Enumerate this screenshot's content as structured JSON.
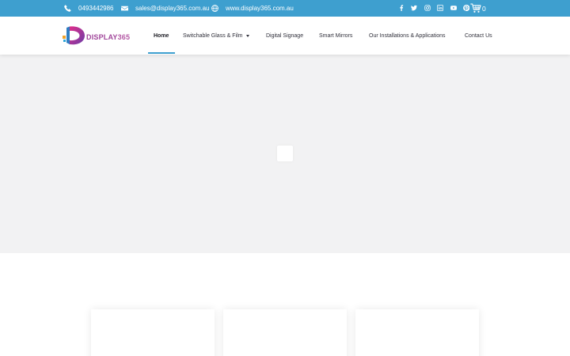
{
  "topbar": {
    "phone": "0493442986",
    "email": "sales@display365.com.au",
    "website": "www.display365.com.au",
    "phone_icon": "phone-icon",
    "email_icon": "envelope-icon",
    "website_icon": "globe-icon",
    "social": [
      "facebook-icon",
      "twitter-icon",
      "instagram-icon",
      "linkedin-icon",
      "youtube-icon",
      "pinterest-icon"
    ],
    "cart_count": "0",
    "background": "#3e9fcf"
  },
  "header": {
    "logo_text": "DISPLAY",
    "logo_num": "365",
    "nav": [
      {
        "label": "Home",
        "active": true
      },
      {
        "label": "Switchable Glass & Film",
        "dropdown": true
      },
      {
        "label": "Digital Signage"
      },
      {
        "label": "Smart Mirrors"
      },
      {
        "label": "Our Installations & Applications"
      },
      {
        "label": "Contact Us"
      }
    ],
    "accent": "#3e9fcf"
  },
  "hero": {
    "background": "#f2f2f3"
  }
}
